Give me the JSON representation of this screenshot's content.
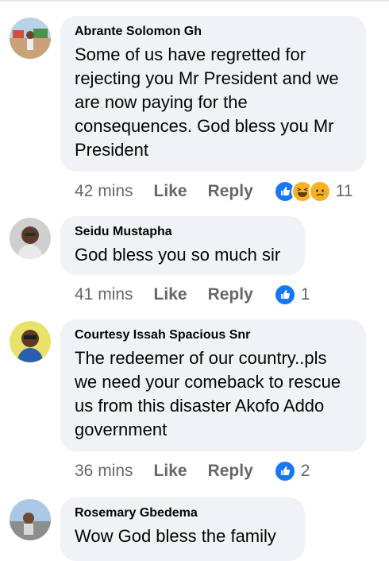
{
  "comments": [
    {
      "author": "Abrante Solomon Gh",
      "lines": [
        "Some of us have regretted for",
        "rejecting you Mr President and we",
        "are now paying for the",
        "consequences. God bless you Mr",
        "President"
      ],
      "time": "42 mins",
      "like": "Like",
      "reply": "Reply",
      "reaction_icons": [
        "like-reaction-icon",
        "haha-reaction-icon",
        "sad-reaction-icon"
      ],
      "reaction_count": "11"
    },
    {
      "author": "Seidu Mustapha",
      "lines": [
        "God bless you so much sir"
      ],
      "time": "41 mins",
      "like": "Like",
      "reply": "Reply",
      "reaction_icons": [
        "like-reaction-icon"
      ],
      "reaction_count": "1"
    },
    {
      "author": "Courtesy Issah Spacious Snr",
      "lines": [
        "The redeemer of our country..pls",
        "we need your comeback to rescue",
        "us from this disaster Akofo Addo",
        "government"
      ],
      "time": "36 mins",
      "like": "Like",
      "reply": "Reply",
      "reaction_icons": [
        "like-reaction-icon"
      ],
      "reaction_count": "2"
    },
    {
      "author": "Rosemary Gbedema",
      "lines": [
        "Wow  God bless the family"
      ],
      "time": "",
      "like": "",
      "reply": "",
      "reaction_icons": [],
      "reaction_count": ""
    }
  ],
  "colors": {
    "bubble": "#f0f2f5",
    "meta_text": "#65676b",
    "like_blue": "#1877f2",
    "emoji_yellow": "#f7b125"
  }
}
